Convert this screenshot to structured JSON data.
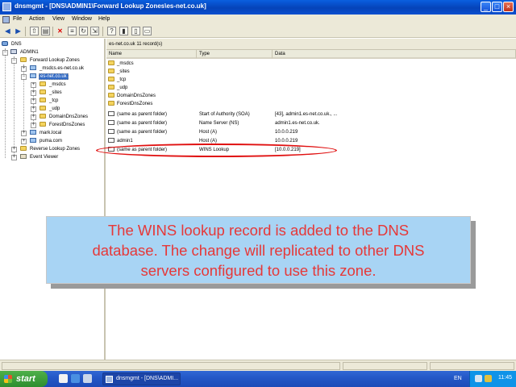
{
  "window": {
    "title": "dnsmgmt - [DNS\\ADMIN1\\Forward Lookup Zones\\es-net.co.uk]",
    "buttons": {
      "minimize": "_",
      "maximize": "□",
      "close": "×"
    }
  },
  "menu": [
    "File",
    "Action",
    "View",
    "Window",
    "Help"
  ],
  "tree": {
    "root": "DNS",
    "server": "ADMIN1",
    "forward_zones": "Forward Lookup Zones",
    "msdcs_zone": "_msdcs.es-net.co.uk",
    "selected_zone": "es-net.co.uk",
    "subfolders": [
      "_msdcs",
      "_sites",
      "_tcp",
      "_udp",
      "DomainDnsZones",
      "ForestDnsZones"
    ],
    "other_zones": [
      "mark.local",
      "puma.com"
    ],
    "reverse_zones": "Reverse Lookup Zones",
    "event_viewer": "Event Viewer"
  },
  "right_pane": {
    "zone_header": "es-net.co.uk    11 record(s)",
    "columns": [
      "Name",
      "Type",
      "Data"
    ],
    "records": [
      {
        "name": "_msdcs",
        "type": "",
        "data": ""
      },
      {
        "name": "_sites",
        "type": "",
        "data": ""
      },
      {
        "name": "_tcp",
        "type": "",
        "data": ""
      },
      {
        "name": "_udp",
        "type": "",
        "data": ""
      },
      {
        "name": "DomainDnsZones",
        "type": "",
        "data": ""
      },
      {
        "name": "ForestDnsZones",
        "type": "",
        "data": ""
      },
      {
        "name": "(same as parent folder)",
        "type": "Start of Authority (SOA)",
        "data": "[43], admin1.es-net.co.uk., ..."
      },
      {
        "name": "(same as parent folder)",
        "type": "Name Server (NS)",
        "data": "admin1.es-net.co.uk."
      },
      {
        "name": "(same as parent folder)",
        "type": "Host (A)",
        "data": "10.0.0.219"
      },
      {
        "name": "admin1",
        "type": "Host (A)",
        "data": "10.0.0.219"
      },
      {
        "name": "(same as parent folder)",
        "type": "WINS Lookup",
        "data": "[10.0.0.219]"
      }
    ]
  },
  "callout": {
    "lines": [
      "The WINS lookup record is added to the DNS",
      "database. The change will replicated to other DNS",
      "servers configured to use this zone."
    ]
  },
  "taskbar": {
    "start": "start",
    "task": "dnsmgmt - [DNS\\ADMI...",
    "language": "EN",
    "clock": "11:45"
  }
}
